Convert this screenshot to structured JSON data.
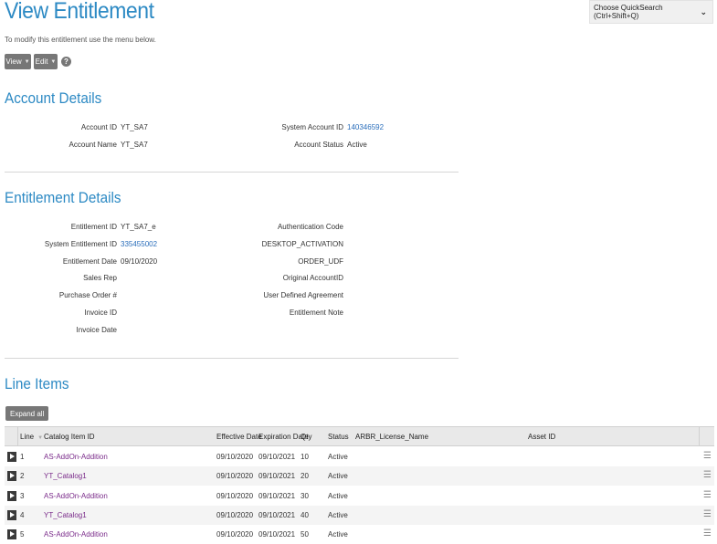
{
  "page": {
    "title": "View Entitlement",
    "subtitle": "To modify this entitlement use the menu below.",
    "quicksearch": "Choose QuickSearch (Ctrl+Shift+Q)",
    "buttons": {
      "view": "View",
      "edit": "Edit",
      "help": "?"
    }
  },
  "account": {
    "title": "Account Details",
    "fields": {
      "account_id_label": "Account ID",
      "account_id": "YT_SA7",
      "account_name_label": "Account Name",
      "account_name": "YT_SA7",
      "system_account_id_label": "System Account ID",
      "system_account_id": "140346592",
      "account_status_label": "Account Status",
      "account_status": "Active"
    }
  },
  "entitlement": {
    "title": "Entitlement Details",
    "fields": {
      "entitlement_id_label": "Entitlement ID",
      "entitlement_id": "YT_SA7_e",
      "system_entitlement_id_label": "System Entitlement ID",
      "system_entitlement_id": "335455002",
      "entitlement_date_label": "Entitlement Date",
      "entitlement_date": "09/10/2020",
      "sales_rep_label": "Sales Rep",
      "purchase_order_label": "Purchase Order #",
      "invoice_id_label": "Invoice ID",
      "invoice_date_label": "Invoice Date",
      "auth_code_label": "Authentication Code",
      "auth_code_value": "DESKTOP_ACTIVATION",
      "order_udf": "ORDER_UDF",
      "original_account_label": "Original AccountID",
      "user_defined_agreement_label": "User Defined Agreement",
      "entitlement_note_label": "Entitlement Note"
    }
  },
  "line_items": {
    "title": "Line Items",
    "expand_all": "Expand all",
    "columns": {
      "line": "Line",
      "catalog": "Catalog Item ID",
      "effective": "Effective Date",
      "expiration": "Expiration Date",
      "qty": "Qty",
      "status": "Status",
      "license": "ARBR_License_Name",
      "asset": "Asset ID"
    },
    "rows": [
      {
        "line": "1",
        "catalog": "AS-AddOn-Addition",
        "effective": "09/10/2020",
        "expiration": "09/10/2021",
        "qty": "10",
        "status": "Active"
      },
      {
        "line": "2",
        "catalog": "YT_Catalog1",
        "effective": "09/10/2020",
        "expiration": "09/10/2021",
        "qty": "20",
        "status": "Active"
      },
      {
        "line": "3",
        "catalog": "AS-AddOn-Addition",
        "effective": "09/10/2020",
        "expiration": "09/10/2021",
        "qty": "30",
        "status": "Active"
      },
      {
        "line": "4",
        "catalog": "YT_Catalog1",
        "effective": "09/10/2020",
        "expiration": "09/10/2021",
        "qty": "40",
        "status": "Active"
      },
      {
        "line": "5",
        "catalog": "AS-AddOn-Addition",
        "effective": "09/10/2020",
        "expiration": "09/10/2021",
        "qty": "50",
        "status": "Active"
      }
    ]
  }
}
